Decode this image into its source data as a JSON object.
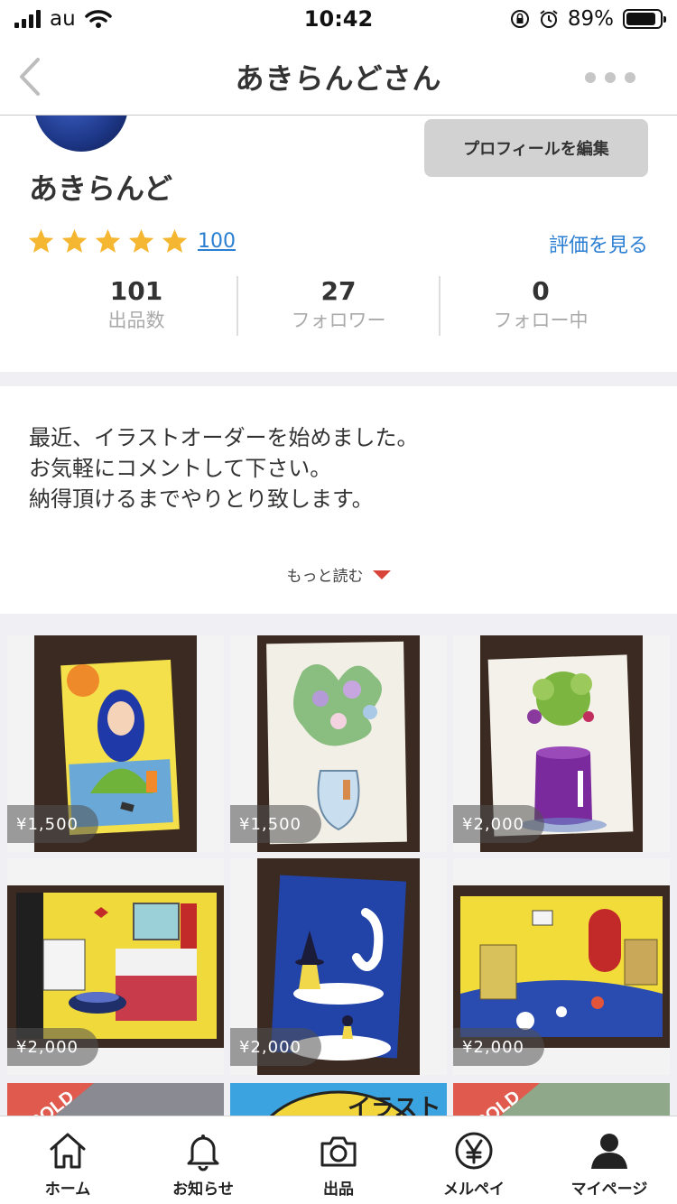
{
  "status_bar": {
    "carrier": "au",
    "time": "10:42",
    "battery_percent": "89%",
    "battery_level": 0.89
  },
  "header": {
    "title": "あきらんどさん"
  },
  "profile": {
    "name": "あきらんど",
    "edit_button_label": "プロフィールを編集",
    "rating_stars": 5,
    "rating_count": "100",
    "see_reviews_label": "評価を見る",
    "stats": [
      {
        "value": "101",
        "label": "出品数"
      },
      {
        "value": "27",
        "label": "フォロワー"
      },
      {
        "value": "0",
        "label": "フォロー中"
      }
    ]
  },
  "bio": {
    "lines": [
      "最近、イラストオーダーを始めました。",
      "お気軽にコメントして下さい。",
      "納得頂けるまでやりとり致します。"
    ],
    "read_more_label": "もっと読む"
  },
  "items": [
    {
      "price": "¥1,500"
    },
    {
      "price": "¥1,500"
    },
    {
      "price": "¥2,000"
    },
    {
      "price": "¥2,000"
    },
    {
      "price": "¥2,000"
    },
    {
      "price": "¥2,000"
    }
  ],
  "partial_items": [
    {
      "badge": "SOLD"
    },
    {
      "badge_text": "イラスト"
    },
    {
      "badge": "SOLD"
    }
  ],
  "tab_bar": [
    {
      "label": "ホーム",
      "icon": "home-icon"
    },
    {
      "label": "お知らせ",
      "icon": "bell-icon"
    },
    {
      "label": "出品",
      "icon": "camera-icon"
    },
    {
      "label": "メルペイ",
      "icon": "yen-icon"
    },
    {
      "label": "マイページ",
      "icon": "person-icon"
    }
  ],
  "colors": {
    "accent_blue": "#2b7fd3",
    "star": "#f5b731",
    "caret": "#d9443a",
    "sold": "#e05a4e"
  }
}
